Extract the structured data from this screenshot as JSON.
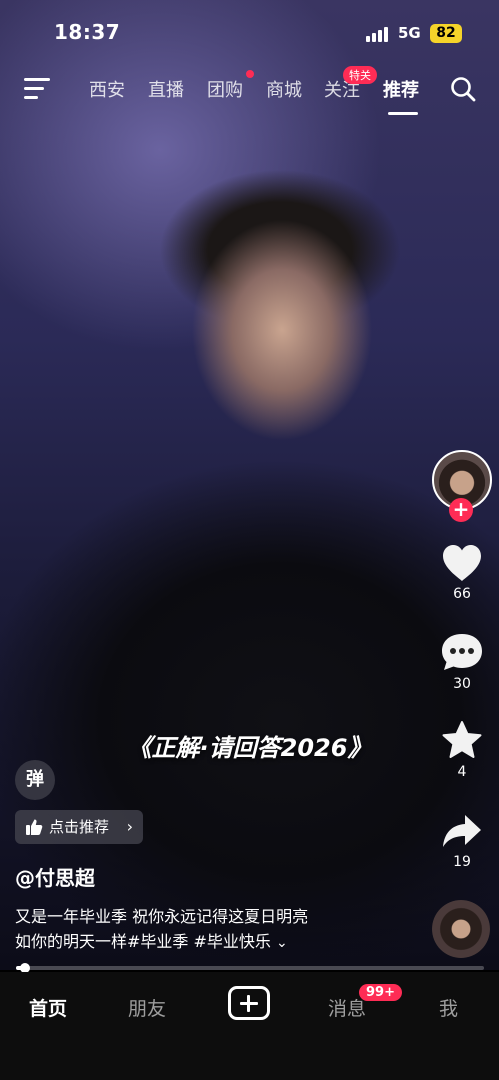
{
  "status": {
    "time": "18:37",
    "network": "5G",
    "battery": "82"
  },
  "top_tabs": [
    "西安",
    "直播",
    "团购",
    "商城",
    "关注",
    "推荐"
  ],
  "top_badge": "特关",
  "video": {
    "subtitle": "《正解·请回答2026》"
  },
  "actions": {
    "likes": "66",
    "comments": "30",
    "favorites": "4",
    "shares": "19"
  },
  "danmu_label": "弹",
  "recommend_label": "点击推荐",
  "author": "@付思超",
  "caption_line1": "又是一年毕业季 祝你永远记得这夏日明亮",
  "caption_line2": "如你的明天一样#毕业季 #毕业快乐",
  "bottom_nav": {
    "home": "首页",
    "friends": "朋友",
    "messages": "消息",
    "me": "我",
    "messages_badge": "99+"
  },
  "progress": 0.02,
  "colors": {
    "accent": "#fe2c55",
    "battery": "#f5d42a"
  }
}
